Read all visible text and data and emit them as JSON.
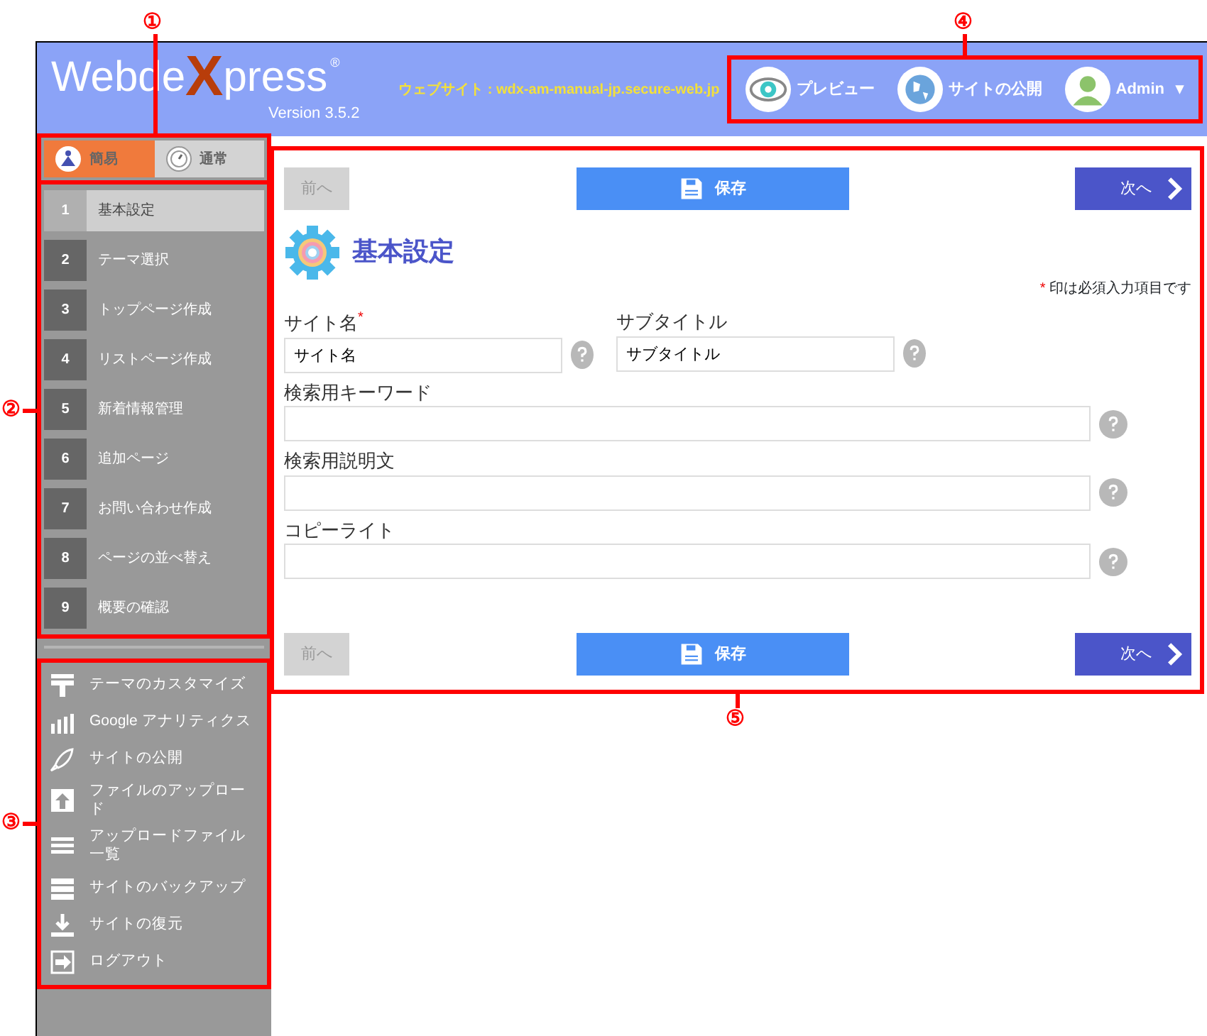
{
  "header": {
    "logo": {
      "before": "Webde",
      "x": "X",
      "after": "press",
      "registered": "®",
      "version": "Version 3.5.2"
    },
    "website": "ウェブサイト : wdx-am-manual-jp.secure-web.jp",
    "actions": [
      {
        "kind": "preview",
        "label": "プレビュー"
      },
      {
        "kind": "publish",
        "label": "サイトの公開"
      },
      {
        "kind": "user",
        "label": "Admin",
        "caret": "▾"
      }
    ]
  },
  "sidebar": {
    "modes": [
      {
        "label": "簡易",
        "selected": true
      },
      {
        "label": "通常",
        "selected": false
      }
    ],
    "steps": [
      {
        "number": "1",
        "label": "基本設定",
        "selected": true
      },
      {
        "number": "2",
        "label": "テーマ選択",
        "selected": false
      },
      {
        "number": "3",
        "label": "トップページ作成",
        "selected": false
      },
      {
        "number": "4",
        "label": "リストページ作成",
        "selected": false
      },
      {
        "number": "5",
        "label": "新着情報管理",
        "selected": false
      },
      {
        "number": "6",
        "label": "追加ページ",
        "selected": false
      },
      {
        "number": "7",
        "label": "お問い合わせ作成",
        "selected": false
      },
      {
        "number": "8",
        "label": "ページの並べ替え",
        "selected": false
      },
      {
        "number": "9",
        "label": "概要の確認",
        "selected": false
      }
    ],
    "tools": [
      {
        "label": "テーマのカスタマイズ"
      },
      {
        "label": "Google アナリティクス"
      },
      {
        "label": "サイトの公開"
      },
      {
        "label": "ファイルのアップロード"
      },
      {
        "label": "アップロードファイル一覧"
      },
      {
        "label": "サイトのバックアップ"
      },
      {
        "label": "サイトの復元"
      },
      {
        "label": "ログアウト"
      }
    ]
  },
  "form": {
    "nav_top": {
      "prev": {
        "label": "前へ",
        "disabled": true
      },
      "save": {
        "label": "保存"
      },
      "next": {
        "label": "次へ"
      }
    },
    "title": "基本設定",
    "required_note": {
      "mark": "*",
      "text": "印は必須入力項目です"
    },
    "fields": [
      {
        "kind": "half",
        "label": "サイト名",
        "required_mark": "*",
        "value": "サイト名"
      },
      {
        "kind": "half",
        "label": "サブタイトル",
        "value": "サブタイトル"
      },
      {
        "kind": "full",
        "label": "検索用キーワード"
      },
      {
        "kind": "full",
        "label": "検索用説明文"
      },
      {
        "kind": "full",
        "label": "コピーライト"
      }
    ],
    "nav_bottom": {
      "prev": {
        "label": "前へ",
        "disabled": true
      },
      "save": {
        "label": "保存"
      },
      "next": {
        "label": "次へ"
      }
    }
  },
  "annotations": [
    {
      "label": "①"
    },
    {
      "label": "②"
    },
    {
      "label": "③"
    },
    {
      "label": "④"
    },
    {
      "label": "⑤"
    }
  ]
}
